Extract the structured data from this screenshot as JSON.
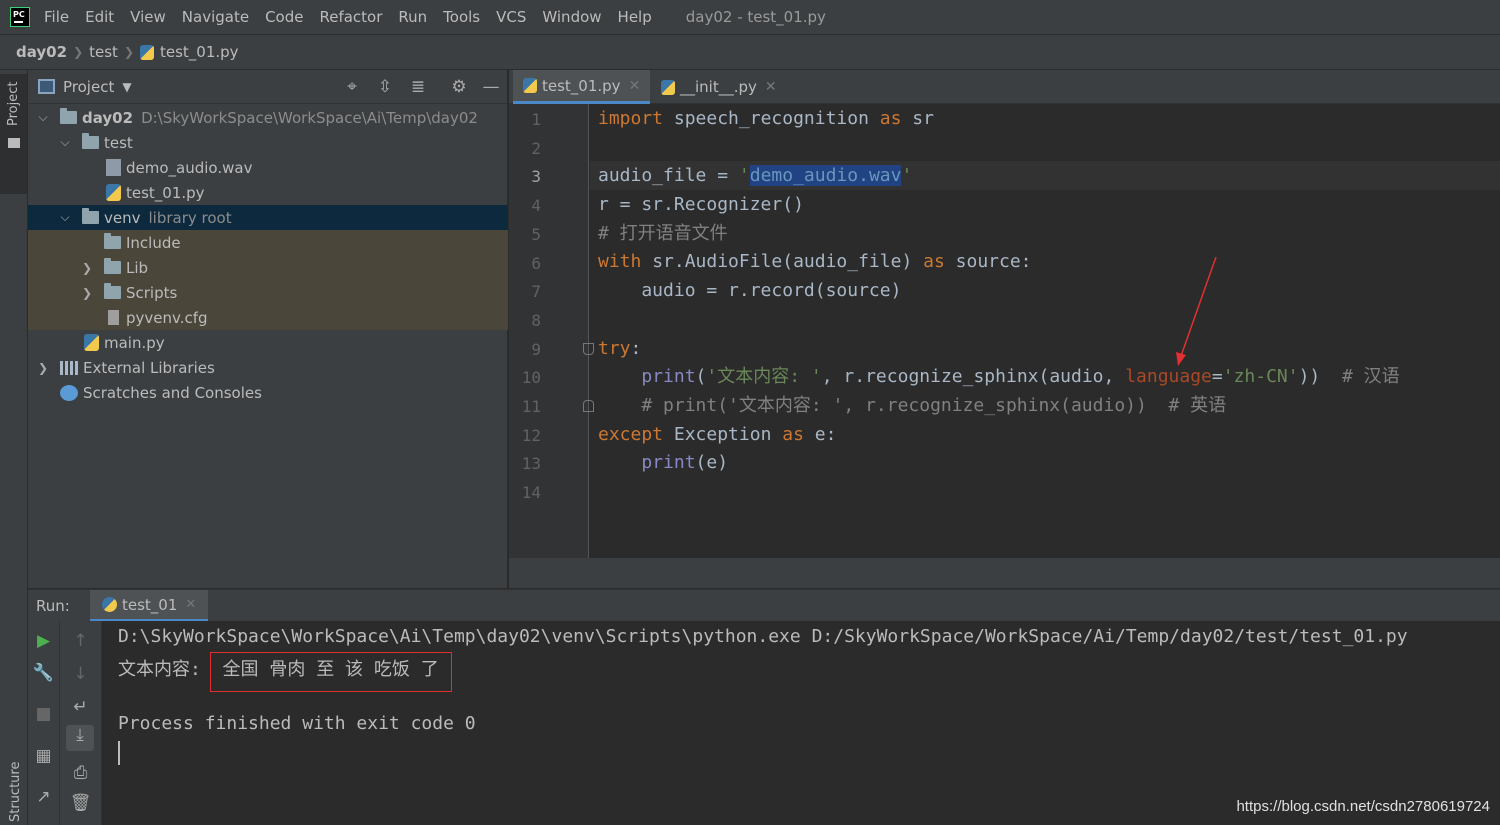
{
  "menubar": {
    "logo_text": "PC",
    "items": [
      "File",
      "Edit",
      "View",
      "Navigate",
      "Code",
      "Refactor",
      "Run",
      "Tools",
      "VCS",
      "Window",
      "Help"
    ],
    "window_title": "day02 - test_01.py"
  },
  "navbar": {
    "crumbs": [
      "day02",
      "test",
      "test_01.py"
    ]
  },
  "left_stripe": {
    "project_label": "Project",
    "structure_label": "Structure"
  },
  "project_panel": {
    "title": "Project",
    "tree": [
      {
        "label": "day02",
        "hint": "D:\\SkyWorkSpace\\WorkSpace\\Ai\\Temp\\day02"
      },
      {
        "label": "test"
      },
      {
        "label": "demo_audio.wav"
      },
      {
        "label": "test_01.py"
      },
      {
        "label": "venv",
        "hint": "library root"
      },
      {
        "label": "Include"
      },
      {
        "label": "Lib"
      },
      {
        "label": "Scripts"
      },
      {
        "label": "pyvenv.cfg"
      },
      {
        "label": "main.py"
      },
      {
        "label": "External Libraries"
      },
      {
        "label": "Scratches and Consoles"
      }
    ]
  },
  "editor": {
    "tabs": [
      {
        "label": "test_01.py"
      },
      {
        "label": "__init__.py"
      }
    ],
    "line_numbers": [
      "1",
      "2",
      "3",
      "4",
      "5",
      "6",
      "7",
      "8",
      "9",
      "10",
      "11",
      "12",
      "13",
      "14"
    ],
    "code": {
      "l1_kw": "import",
      "l1_rest": " speech_recognition ",
      "l1_as": "as",
      "l1_end": " sr",
      "l3_a": "audio_file = ",
      "l3_q1": "'",
      "l3_sel": "demo_audio.wav",
      "l3_q2": "'",
      "l4": "r = sr.Recognizer()",
      "l5": "# 打开语音文件",
      "l6_kw": "with",
      "l6_mid": " sr.AudioFile(audio_file) ",
      "l6_as": "as",
      "l6_end": " source:",
      "l7": "    audio = r.record(source)",
      "l9_kw": "try",
      "l9_end": ":",
      "l10_indent": "    ",
      "l10_fn": "print",
      "l10_a": "(",
      "l10_str": "'文本内容: '",
      "l10_b": ", r.recognize_sphinx(audio, ",
      "l10_param": "language",
      "l10_eq": "=",
      "l10_str2": "'zh-CN'",
      "l10_c": "))  ",
      "l10_cmt": "# 汉语",
      "l11": "    # print('文本内容: ', r.recognize_sphinx(audio))  # 英语",
      "l12_kw": "except",
      "l12_mid": " Exception ",
      "l12_as": "as",
      "l12_end": " e:",
      "l13_indent": "    ",
      "l13_fn": "print",
      "l13_end": "(e)"
    }
  },
  "run": {
    "label": "Run:",
    "tab_label": "test_01",
    "console": {
      "cmd": "D:\\SkyWorkSpace\\WorkSpace\\Ai\\Temp\\day02\\venv\\Scripts\\python.exe D:/SkyWorkSpace/WorkSpace/Ai/Temp/day02/test/test_01.py",
      "result_prefix": "文本内容: ",
      "result_text": "全国 骨肉 至 该 吃饭 了",
      "exit": "Process finished with exit code 0"
    }
  },
  "watermark": "https://blog.csdn.net/csdn2780619724",
  "colors": {
    "keyword": "#cc7832",
    "string": "#6a8759",
    "comment": "#808080",
    "annotation": "#e03030",
    "accent": "#4a88c7"
  }
}
